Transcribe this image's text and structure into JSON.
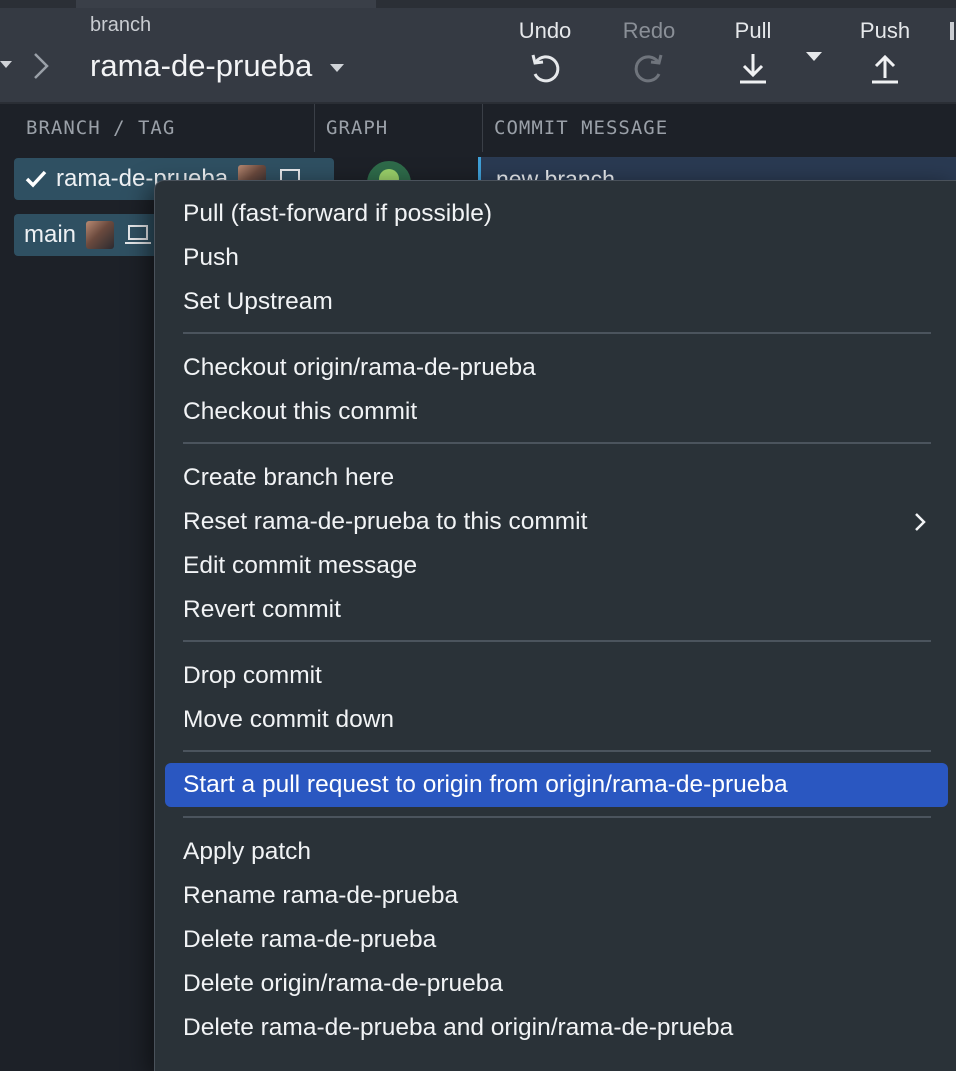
{
  "toolbar": {
    "branch_caption": "branch",
    "branch_name": "rama-de-prueba",
    "undo_label": "Undo",
    "redo_label": "Redo",
    "pull_label": "Pull",
    "push_label": "Push"
  },
  "columns": {
    "branch_tag": "BRANCH / TAG",
    "graph": "GRAPH",
    "commit_message": "COMMIT MESSAGE"
  },
  "refs": [
    {
      "name": "rama-de-prueba",
      "checked": true
    },
    {
      "name": "main",
      "checked": false
    }
  ],
  "commit": {
    "message": "new branch"
  },
  "context_menu": {
    "items": [
      "Pull (fast-forward if possible)",
      "Push",
      "Set Upstream",
      "Checkout origin/rama-de-prueba",
      "Checkout this commit",
      "Create branch here",
      "Reset rama-de-prueba to this commit",
      "Edit commit message",
      "Revert commit",
      "Drop commit",
      "Move commit down",
      "Start a pull request to origin from origin/rama-de-prueba",
      "Apply patch",
      "Rename rama-de-prueba",
      "Delete rama-de-prueba",
      "Delete origin/rama-de-prueba",
      "Delete rama-de-prueba and origin/rama-de-prueba"
    ],
    "highlighted_item": "Start a pull request to origin from origin/rama-de-prueba"
  },
  "colors": {
    "toolbar_bg": "#353a43",
    "app_bg": "#1d2128",
    "ref_bg": "#2f5062",
    "menu_bg": "#2a3238",
    "highlight": "#2a57c1"
  },
  "icons": [
    "chevron-right-icon",
    "caret-down-icon",
    "undo-icon",
    "redo-icon",
    "pull-arrow-icon",
    "push-arrow-icon",
    "check-icon",
    "avatar",
    "laptop-icon",
    "submenu-chevron-icon"
  ]
}
